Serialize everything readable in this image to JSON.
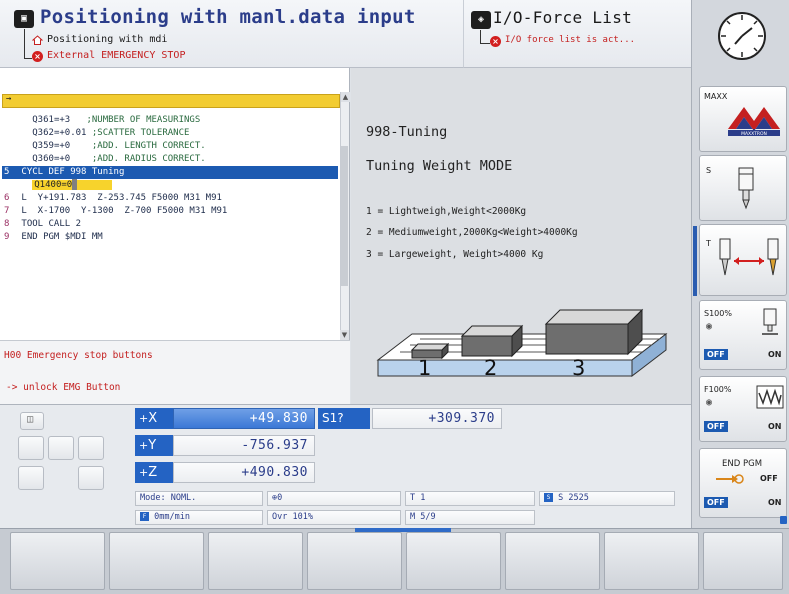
{
  "header": {
    "mode_icon": "machine-mode-icon",
    "title": "Positioning with manl.data input",
    "sub_mode": "Positioning with mdi",
    "error_text": "External EMERGENCY STOP",
    "right_title": "I/O-Force List",
    "right_error": "I/O force list is act..."
  },
  "program": {
    "lines": [
      {
        "num": "",
        "code": "Q361=+3",
        "comment": ";NUMBER OF MEASURINGS"
      },
      {
        "num": "",
        "code": "Q362=+0.01",
        "comment": ";SCATTER TOLERANCE"
      },
      {
        "num": "",
        "code": "Q359=+0",
        "comment": ";ADD. LENGTH CORRECT."
      },
      {
        "num": "",
        "code": "Q360=+0",
        "comment": ";ADD. RADIUS CORRECT."
      },
      {
        "num": "5",
        "code": "CYCL DEF 998 Tuning",
        "comment": ""
      },
      {
        "num": "",
        "code": "Q1400=0",
        "comment": ""
      },
      {
        "num": "6",
        "code": "L  Y+191.783  Z-253.745 F5000 M31 M91",
        "comment": ""
      },
      {
        "num": "7",
        "code": "L  X-1700  Y-1300  Z-700 F5000 M31 M91",
        "comment": ""
      },
      {
        "num": "8",
        "code": "TOOL CALL 2",
        "comment": ""
      },
      {
        "num": "9",
        "code": "END PGM $MDI MM",
        "comment": ""
      }
    ],
    "selected_index": 4
  },
  "messages": {
    "error_line": "H00 Emergency stop buttons",
    "hint_line": "-> unlock EMG Button"
  },
  "info": {
    "cycle": "998-Tuning",
    "mode": "Tuning Weight MODE",
    "options": [
      "1 = Lightweigh,Weight<2000Kg",
      "2 = Mediumweight,2000Kg<Weight>4000Kg",
      "3 = Largeweight, Weight>4000 Kg"
    ],
    "diagram_labels": [
      "1",
      "2",
      "3"
    ]
  },
  "axes": [
    {
      "name": "X",
      "value": "+49.830"
    },
    {
      "name": "Y",
      "value": "-756.937"
    },
    {
      "name": "Z",
      "value": "+490.830"
    }
  ],
  "spindle": {
    "label": "S1?",
    "value": "+309.370"
  },
  "status": {
    "mode": "Mode: NOML.",
    "datum": "0",
    "tool": "T 1",
    "speed": "S 2525",
    "feed": "0mm/min",
    "override": "Ovr 101%",
    "mfunc": "M 5/9"
  },
  "softkeys": {
    "maxx_label": "MAXX",
    "maxx_brand": "MAXXTRON",
    "s_label": "S",
    "t_label": "T",
    "s100_label": "S100%",
    "f100_label": "F100%",
    "off_label": "OFF",
    "on_label": "ON",
    "end_pgm_label": "END PGM",
    "end_pgm_off": "OFF"
  },
  "colors": {
    "accent_blue": "#2463c3",
    "highlight_yellow": "#f2cc32",
    "error_red": "#c42020",
    "title_blue": "#2b3d8a"
  }
}
